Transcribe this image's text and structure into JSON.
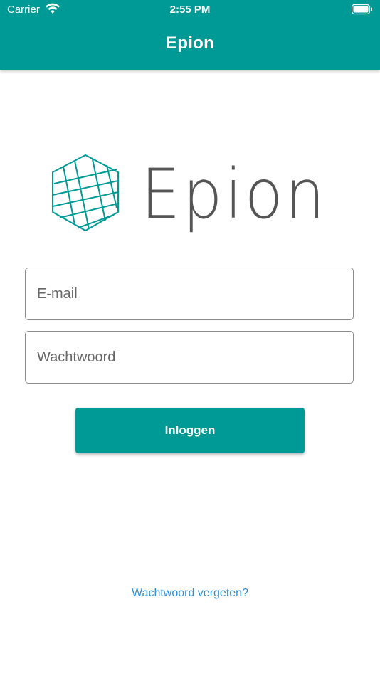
{
  "status_bar": {
    "carrier": "Carrier",
    "time": "2:55 PM"
  },
  "app_bar": {
    "title": "Epion",
    "color": "#009a96"
  },
  "logo": {
    "wordmark": "Epion",
    "icon": "hexagon-grid-icon",
    "icon_color": "#009a96",
    "text_color": "#555555"
  },
  "form": {
    "email_placeholder": "E-mail",
    "password_placeholder": "Wachtwoord",
    "login_label": "Inloggen",
    "forgot_password_label": "Wachtwoord vergeten?"
  },
  "colors": {
    "accent": "#009a96",
    "link": "#2b8fd6"
  }
}
